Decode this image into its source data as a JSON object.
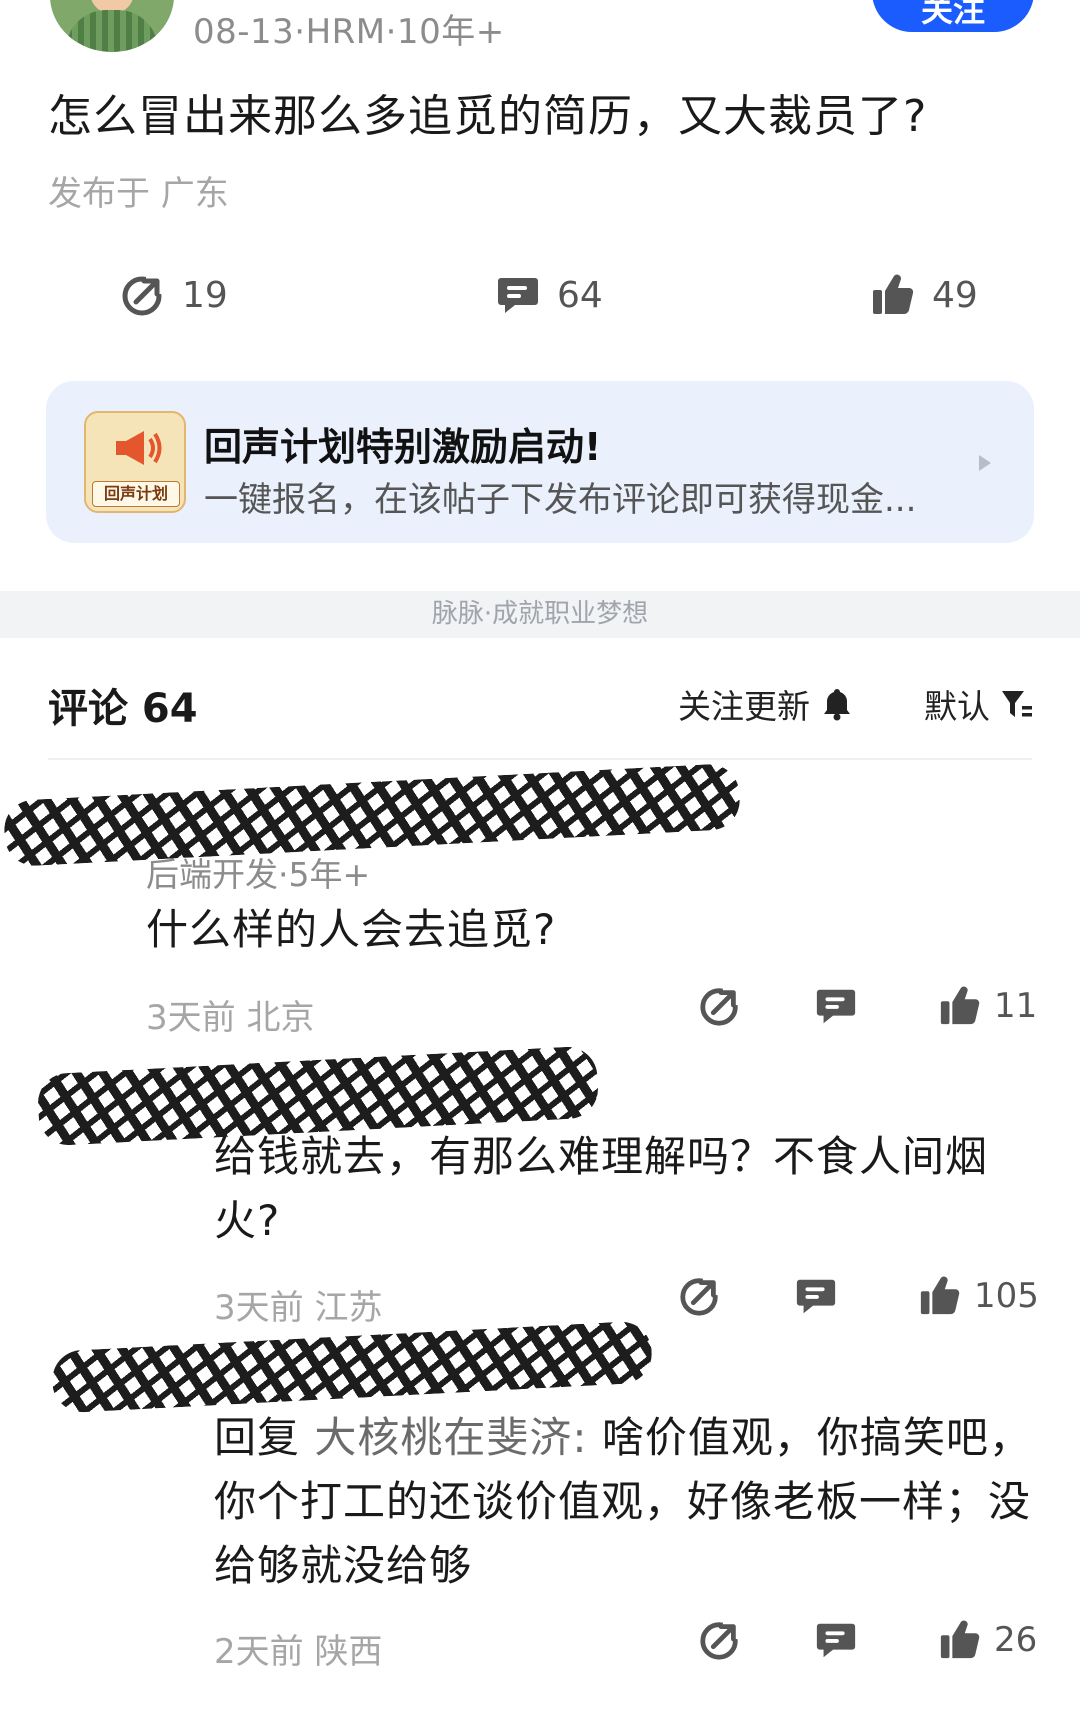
{
  "post": {
    "meta": "08-13·HRM·10年+",
    "follow_label": "关注",
    "title": "怎么冒出来那么多追觅的简历，又大裁员了?",
    "location": "发布于 广东",
    "actions": {
      "share": "19",
      "comment": "64",
      "like": "49"
    }
  },
  "banner": {
    "icon_label": "回声计划",
    "title": "回声计划特别激励启动!",
    "subtitle": "一键报名，在该帖子下发布评论即可获得现金..."
  },
  "slogan": "脉脉·成就职业梦想",
  "comments_header": {
    "title": "评论 64",
    "follow_updates": "关注更新",
    "sort": "默认"
  },
  "comments": [
    {
      "author_meta": "后端开发·5年+",
      "text": "什么样的人会去追觅?",
      "time_location": "3天前  北京",
      "likes": "11"
    },
    {
      "text": "给钱就去，有那么难理解吗？不食人间烟火?",
      "time_location": "3天前  江苏",
      "likes": "105"
    },
    {
      "reply_prefix": "回复 ",
      "reply_to": "大核桃在斐济:",
      "text": " 啥价值观，你搞笑吧，你个打工的还谈价值观，好像老板一样；没给够就没给够",
      "time_location": "2天前  陕西",
      "likes": "26"
    }
  ],
  "colors": {
    "accent": "#1b5cff",
    "banner_bg": "#eaf1fd",
    "link": "#2a62d8"
  }
}
